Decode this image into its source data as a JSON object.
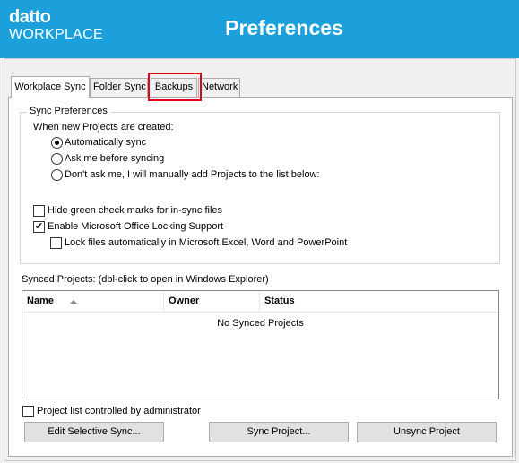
{
  "header": {
    "logo_top": "datto",
    "logo_bottom": "WORKPLACE",
    "title": "Preferences",
    "background": "#1ba0dc"
  },
  "tabs": [
    {
      "label": "Workplace Sync",
      "active": true
    },
    {
      "label": "Folder Sync",
      "active": false
    },
    {
      "label": "Backups",
      "active": false,
      "highlighted": true
    },
    {
      "label": "Network",
      "active": false
    }
  ],
  "sync_preferences": {
    "title": "Sync Preferences",
    "prompt": "When new Projects are created:",
    "options": [
      {
        "label": "Automatically sync",
        "selected": true
      },
      {
        "label": "Ask me before syncing",
        "selected": false
      },
      {
        "label": "Don't ask me, I will manually add Projects to the list below:",
        "selected": false
      }
    ],
    "checkboxes": [
      {
        "label": "Hide green check marks for in-sync files",
        "checked": false
      },
      {
        "label": "Enable Microsoft Office Locking Support",
        "checked": true
      },
      {
        "label": "Lock files automatically in Microsoft Excel, Word and PowerPoint",
        "checked": false
      }
    ]
  },
  "synced_projects": {
    "label": "Synced Projects: (dbl-click to open in Windows Explorer)",
    "columns": [
      "Name",
      "Owner",
      "Status"
    ],
    "empty_message": "No Synced Projects"
  },
  "admin_checkbox": {
    "label": "Project list controlled by administrator",
    "checked": false
  },
  "buttons": {
    "edit_selective_sync": "Edit Selective Sync...",
    "sync_project": "Sync Project...",
    "unsync_project": "Unsync Project"
  },
  "check_glyph": "✔",
  "highlight_color": "#e2001a"
}
